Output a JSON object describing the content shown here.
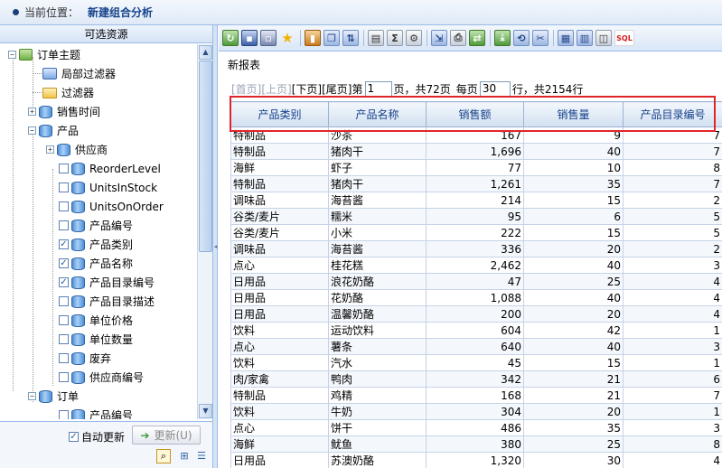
{
  "header": {
    "location_label": "当前位置：",
    "page_title": "新建组合分析"
  },
  "left_panel": {
    "title": "可选资源",
    "tree": [
      {
        "label": "订单主题"
      },
      {
        "label": "局部过滤器"
      },
      {
        "label": "过滤器"
      },
      {
        "label": "销售时间"
      },
      {
        "label": "产品"
      },
      {
        "label": "供应商"
      },
      {
        "label": "ReorderLevel"
      },
      {
        "label": "UnitsInStock"
      },
      {
        "label": "UnitsOnOrder"
      },
      {
        "label": "产品编号"
      },
      {
        "label": "产品类别"
      },
      {
        "label": "产品名称"
      },
      {
        "label": "产品目录编号"
      },
      {
        "label": "产品目录描述"
      },
      {
        "label": "单位价格"
      },
      {
        "label": "单位数量"
      },
      {
        "label": "废弃"
      },
      {
        "label": "供应商编号"
      },
      {
        "label": "订单"
      },
      {
        "label": "产品编号"
      }
    ],
    "auto_update_label": "自动更新",
    "update_button_label": "更新(U)"
  },
  "toolbar": {
    "sql_label": "SQL"
  },
  "report": {
    "title": "新报表",
    "pager": {
      "first": "[首页]",
      "prev": "[上页]",
      "next": "[下页]",
      "last": "[尾页]",
      "page_prefix": "第",
      "page_value": "1",
      "page_suffix": "页，共72页",
      "per_page_prefix": "每页",
      "per_page_value": "30",
      "per_page_suffix": "行，共2154行"
    },
    "columns": [
      "产品类别",
      "产品名称",
      "销售额",
      "销售量",
      "产品目录编号"
    ],
    "rows": [
      [
        "特制品",
        "沙茶",
        "167",
        "9",
        "7"
      ],
      [
        "特制品",
        "猪肉干",
        "1,696",
        "40",
        "7"
      ],
      [
        "海鲜",
        "虾子",
        "77",
        "10",
        "8"
      ],
      [
        "特制品",
        "猪肉干",
        "1,261",
        "35",
        "7"
      ],
      [
        "调味品",
        "海苔酱",
        "214",
        "15",
        "2"
      ],
      [
        "谷类/麦片",
        "糯米",
        "95",
        "6",
        "5"
      ],
      [
        "谷类/麦片",
        "小米",
        "222",
        "15",
        "5"
      ],
      [
        "调味品",
        "海苔酱",
        "336",
        "20",
        "2"
      ],
      [
        "点心",
        "桂花糕",
        "2,462",
        "40",
        "3"
      ],
      [
        "日用品",
        "浪花奶酪",
        "47",
        "25",
        "4"
      ],
      [
        "日用品",
        "花奶酪",
        "1,088",
        "40",
        "4"
      ],
      [
        "日用品",
        "温馨奶酪",
        "200",
        "20",
        "4"
      ],
      [
        "饮料",
        "运动饮料",
        "604",
        "42",
        "1"
      ],
      [
        "点心",
        "薯条",
        "640",
        "40",
        "3"
      ],
      [
        "饮料",
        "汽水",
        "45",
        "15",
        "1"
      ],
      [
        "肉/家禽",
        "鸭肉",
        "342",
        "21",
        "6"
      ],
      [
        "特制品",
        "鸡精",
        "168",
        "21",
        "7"
      ],
      [
        "饮料",
        "牛奶",
        "304",
        "20",
        "1"
      ],
      [
        "点心",
        "饼干",
        "486",
        "35",
        "3"
      ],
      [
        "海鲜",
        "鱿鱼",
        "380",
        "25",
        "8"
      ],
      [
        "日用品",
        "苏澳奶酪",
        "1,320",
        "30",
        "4"
      ]
    ]
  }
}
